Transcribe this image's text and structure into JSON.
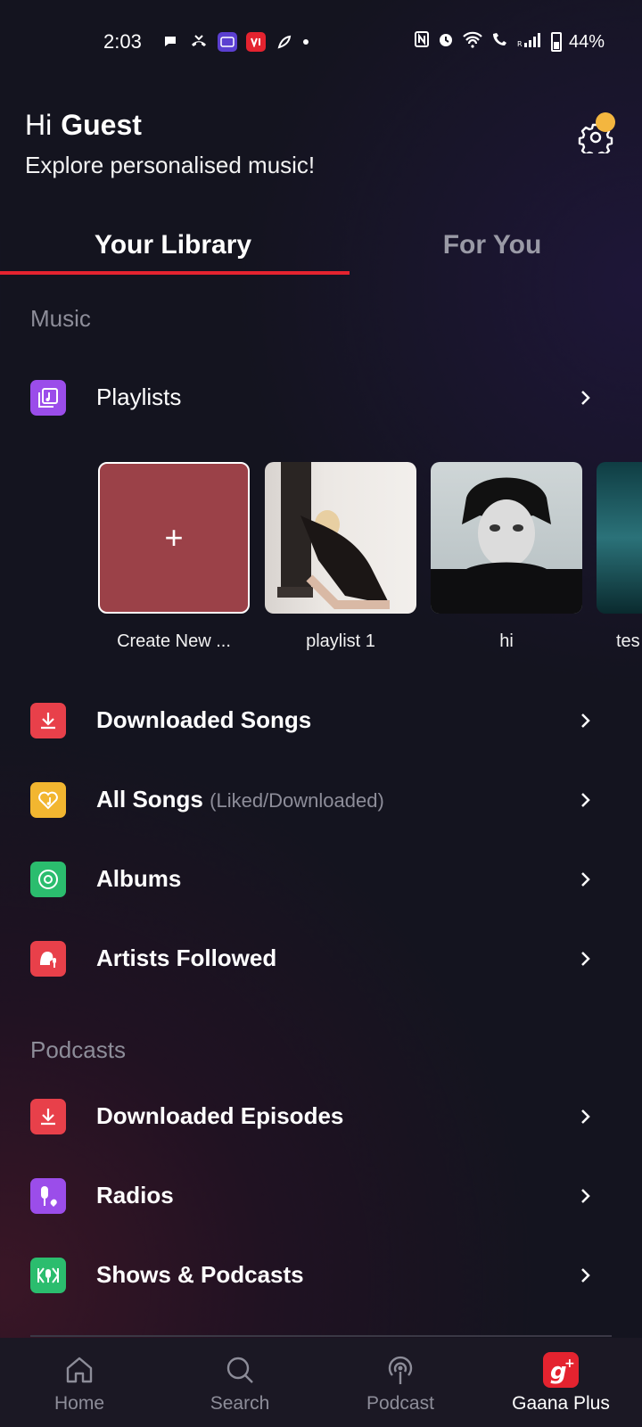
{
  "status_bar": {
    "time": "2:03",
    "battery": "44%"
  },
  "header": {
    "greeting": "Hi",
    "user_name": "Guest",
    "subtitle": "Explore personalised music!"
  },
  "tabs": [
    {
      "label": "Your Library"
    },
    {
      "label": "For You"
    }
  ],
  "music_section": {
    "title": "Music",
    "playlists_label": "Playlists",
    "playlists": [
      {
        "caption": "Create New ..."
      },
      {
        "caption": "playlist 1"
      },
      {
        "caption": "hi"
      },
      {
        "caption": "tes"
      }
    ],
    "items": [
      {
        "label": "Downloaded Songs",
        "sub": ""
      },
      {
        "label": "All Songs",
        "sub": "(Liked/Downloaded)"
      },
      {
        "label": "Albums",
        "sub": ""
      },
      {
        "label": "Artists Followed",
        "sub": ""
      }
    ]
  },
  "podcasts_section": {
    "title": "Podcasts",
    "items": [
      {
        "label": "Downloaded Episodes"
      },
      {
        "label": "Radios"
      },
      {
        "label": "Shows & Podcasts"
      }
    ]
  },
  "bottom_nav": [
    {
      "label": "Home",
      "icon": "home-icon"
    },
    {
      "label": "Search",
      "icon": "search-icon"
    },
    {
      "label": "Podcast",
      "icon": "podcast-icon"
    },
    {
      "label": "Gaana Plus",
      "icon": "gaana-plus-icon"
    }
  ],
  "colors": {
    "accent": "#e4232f",
    "playlists_icon": "#9b4dea",
    "downloaded_songs_icon": "#e8404a",
    "all_songs_icon": "#f2b630",
    "albums_icon": "#2bbd6e",
    "artists_icon": "#e8404a",
    "radios_icon": "#9b4dea",
    "shows_icon": "#2bbd6e"
  }
}
